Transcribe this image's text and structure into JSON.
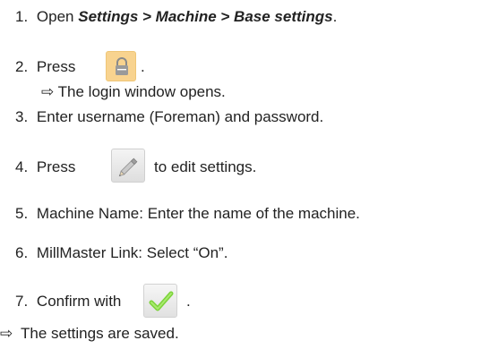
{
  "steps": [
    {
      "num": "1.",
      "text_pre": "Open ",
      "path": "Settings > Machine > Base settings",
      "text_post": "."
    },
    {
      "num": "2.",
      "text_pre": "Press",
      "text_post": "."
    },
    {
      "result": "⇨ The login window opens."
    },
    {
      "num": "3.",
      "text": "Enter username (Foreman) and password."
    },
    {
      "num": "4.",
      "text_pre": "Press",
      "text_post": "to edit settings."
    },
    {
      "num": "5.",
      "text": "Machine Name: Enter the name of the machine."
    },
    {
      "num": "6.",
      "text": "MillMaster Link: Select “On”."
    },
    {
      "num": "7.",
      "text_pre": "Confirm with",
      "text_post": "."
    }
  ],
  "final_result": {
    "arrow": "⇨",
    "text": "The settings are saved."
  },
  "icons": {
    "lock": "lock-icon",
    "pencil": "pencil-icon",
    "check": "checkmark-icon"
  },
  "colors": {
    "text": "#222222",
    "lock_button": "#f8d38f",
    "check_green": "#7cd33a"
  }
}
